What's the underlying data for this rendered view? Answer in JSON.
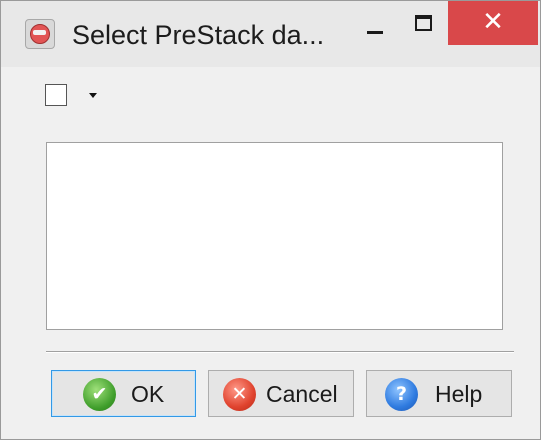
{
  "window": {
    "title": "Select PreStack da...",
    "controls": {
      "minimize": "minimize-icon",
      "maximize": "maximize-icon",
      "close": "close-icon"
    },
    "close_glyph": "✕",
    "close_color": "#d9484a"
  },
  "selector": {
    "checked": false,
    "dropdown_icon": "caret-down-icon"
  },
  "list": {
    "items": []
  },
  "buttons": {
    "ok": {
      "label": "OK",
      "icon": "checkmark-icon",
      "glyph": "✔"
    },
    "cancel": {
      "label": "Cancel",
      "icon": "cancel-icon",
      "glyph": "✕"
    },
    "help": {
      "label": "Help",
      "icon": "help-icon",
      "glyph": "?"
    }
  },
  "colors": {
    "default_button_border": "#3399e6",
    "background": "#f0f0f0"
  }
}
